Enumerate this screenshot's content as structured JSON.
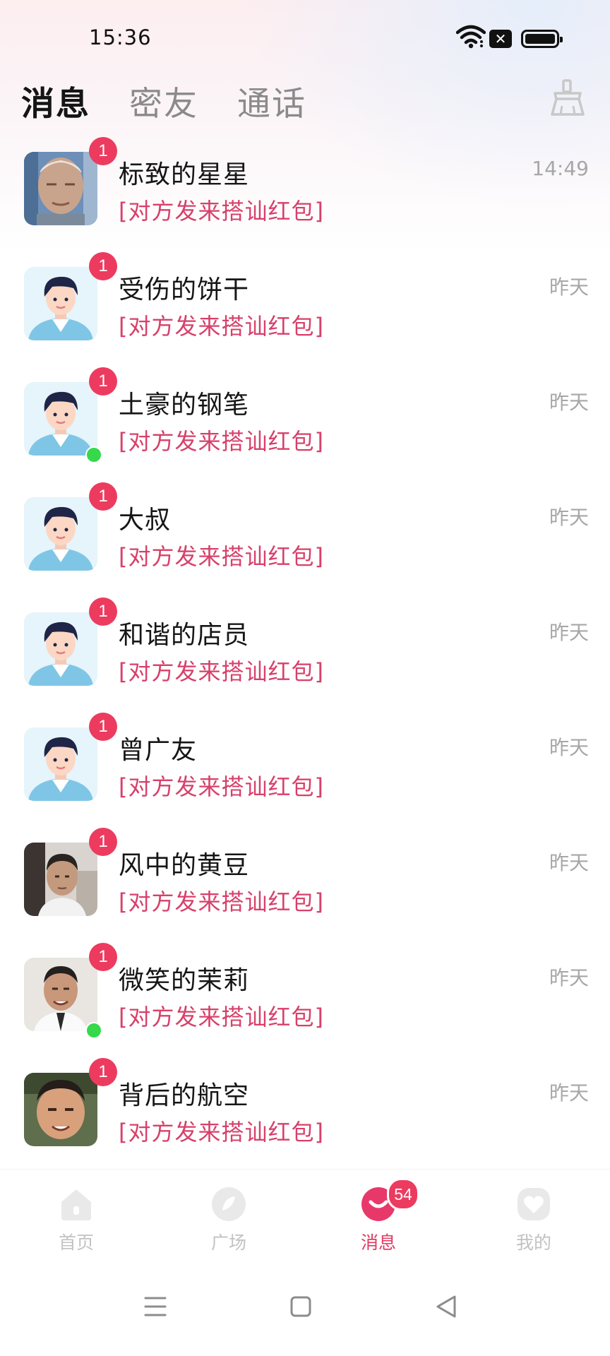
{
  "status_bar": {
    "time": "15:36",
    "icons": [
      "wifi-icon",
      "sim-off-icon",
      "battery-icon"
    ]
  },
  "tabs": [
    {
      "label": "消息",
      "active": true
    },
    {
      "label": "密友",
      "active": false
    },
    {
      "label": "通话",
      "active": false
    }
  ],
  "header": {
    "clear_icon": "broom-icon"
  },
  "messages": [
    {
      "name": "标致的星星",
      "preview": "[对方发来搭讪红包]",
      "time": "14:49",
      "unread": "1",
      "online": false,
      "avatar": "photo-elderly-man"
    },
    {
      "name": "受伤的饼干",
      "preview": "[对方发来搭讪红包]",
      "time": "昨天",
      "unread": "1",
      "online": false,
      "avatar": "cartoon-man"
    },
    {
      "name": "土豪的钢笔",
      "preview": "[对方发来搭讪红包]",
      "time": "昨天",
      "unread": "1",
      "online": true,
      "avatar": "cartoon-man"
    },
    {
      "name": "大叔",
      "preview": "[对方发来搭讪红包]",
      "time": "昨天",
      "unread": "1",
      "online": false,
      "avatar": "cartoon-man"
    },
    {
      "name": "和谐的店员",
      "preview": "[对方发来搭讪红包]",
      "time": "昨天",
      "unread": "1",
      "online": false,
      "avatar": "cartoon-man"
    },
    {
      "name": "曾广友",
      "preview": "[对方发来搭讪红包]",
      "time": "昨天",
      "unread": "1",
      "online": false,
      "avatar": "cartoon-man"
    },
    {
      "name": "风中的黄豆",
      "preview": "[对方发来搭讪红包]",
      "time": "昨天",
      "unread": "1",
      "online": false,
      "avatar": "photo-man"
    },
    {
      "name": "微笑的茉莉",
      "preview": "[对方发来搭讪红包]",
      "time": "昨天",
      "unread": "1",
      "online": true,
      "avatar": "photo-man-white-shirt"
    },
    {
      "name": "背后的航空",
      "preview": "[对方发来搭讪红包]",
      "time": "昨天",
      "unread": "1",
      "online": false,
      "avatar": "photo-man-outdoor"
    }
  ],
  "bottom_nav": [
    {
      "label": "首页",
      "icon": "home-icon",
      "active": false
    },
    {
      "label": "广场",
      "icon": "square-leaf-icon",
      "active": false
    },
    {
      "label": "消息",
      "icon": "message-icon",
      "active": true,
      "badge": "54"
    },
    {
      "label": "我的",
      "icon": "profile-heart-icon",
      "active": false
    }
  ],
  "system_nav": [
    "menu-icon",
    "home-square-icon",
    "back-triangle-icon"
  ],
  "colors": {
    "accent": "#ec3b5f",
    "preview_text": "#d7406a",
    "online": "#35d94b"
  }
}
